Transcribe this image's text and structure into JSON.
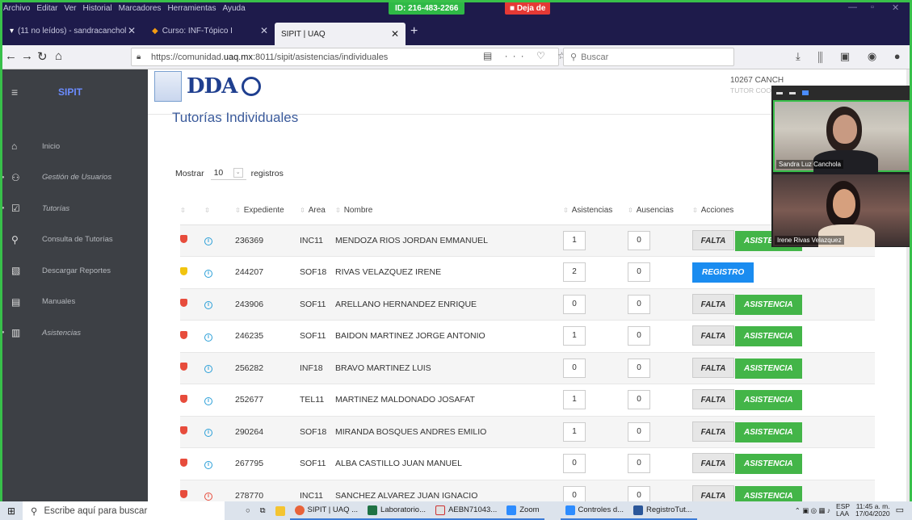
{
  "menu": [
    "Archivo",
    "Editar",
    "Ver",
    "Historial",
    "Marcadores",
    "Herramientas",
    "Ayuda"
  ],
  "zoom": {
    "meeting_id": "ID: 216-483-2266",
    "stop_label": "Deja de"
  },
  "tabs": [
    {
      "label": "(11 no leídos) - sandracanchol"
    },
    {
      "label": "Curso: INF-Tópico I"
    },
    {
      "label": "SIPIT | UAQ"
    }
  ],
  "browser": {
    "url_prefix": "https://comunidad.",
    "url_domain": "uaq.mx",
    "url_suffix": ":8011/sipit/asistencias/individuales",
    "search_placeholder": "Buscar"
  },
  "sidebar": {
    "brand": "SIPIT",
    "items": [
      {
        "label": "Inicio",
        "icon": "home-icon"
      },
      {
        "label": "Gestión de Usuarios",
        "icon": "users-icon"
      },
      {
        "label": "Tutorías",
        "icon": "checkbox-icon"
      },
      {
        "label": "Consulta de Tutorías",
        "icon": "search-icon"
      },
      {
        "label": "Descargar Reportes",
        "icon": "file-icon"
      },
      {
        "label": "Manuales",
        "icon": "file-icon"
      },
      {
        "label": "Asistencias",
        "icon": "chart-icon"
      }
    ]
  },
  "header": {
    "logo_text": "DDA",
    "user_id": "10267 CANCH",
    "user_role": "TUTOR COOR"
  },
  "page": {
    "title": "Tutorías Individuales",
    "show_label": "Mostrar",
    "show_value": "10",
    "records_label": "registros"
  },
  "table": {
    "columns": [
      "",
      "",
      "Expediente",
      "Area",
      "Nombre",
      "Asistencias",
      "Ausencias",
      "Acciones"
    ],
    "falta_label": "FALTA",
    "asistencia_label": "ASISTENCIA",
    "registro_label": "REGISTRO",
    "rows": [
      {
        "status": "red",
        "info": "blue",
        "expediente": "236369",
        "area": "INC11",
        "nombre": "MENDOZA RIOS JORDAN EMMANUEL",
        "asistencias": "1",
        "ausencias": "0",
        "action": "falta-asistencia"
      },
      {
        "status": "yellow",
        "info": "blue",
        "expediente": "244207",
        "area": "SOF18",
        "nombre": "RIVAS VELAZQUEZ IRENE",
        "asistencias": "2",
        "ausencias": "0",
        "action": "registro"
      },
      {
        "status": "red",
        "info": "blue",
        "expediente": "243906",
        "area": "SOF11",
        "nombre": "ARELLANO HERNANDEZ ENRIQUE",
        "asistencias": "0",
        "ausencias": "0",
        "action": "falta-asistencia"
      },
      {
        "status": "red",
        "info": "blue",
        "expediente": "246235",
        "area": "SOF11",
        "nombre": "BAIDON MARTINEZ JORGE ANTONIO",
        "asistencias": "1",
        "ausencias": "0",
        "action": "falta-asistencia"
      },
      {
        "status": "red",
        "info": "blue",
        "expediente": "256282",
        "area": "INF18",
        "nombre": "BRAVO MARTINEZ LUIS",
        "asistencias": "0",
        "ausencias": "0",
        "action": "falta-asistencia"
      },
      {
        "status": "red",
        "info": "blue",
        "expediente": "252677",
        "area": "TEL11",
        "nombre": "MARTINEZ MALDONADO JOSAFAT",
        "asistencias": "1",
        "ausencias": "0",
        "action": "falta-asistencia"
      },
      {
        "status": "red",
        "info": "blue",
        "expediente": "290264",
        "area": "SOF18",
        "nombre": "MIRANDA BOSQUES ANDRES EMILIO",
        "asistencias": "1",
        "ausencias": "0",
        "action": "falta-asistencia"
      },
      {
        "status": "red",
        "info": "blue",
        "expediente": "267795",
        "area": "SOF11",
        "nombre": "ALBA CASTILLO JUAN MANUEL",
        "asistencias": "0",
        "ausencias": "0",
        "action": "falta-asistencia"
      },
      {
        "status": "red",
        "info": "red",
        "expediente": "278770",
        "area": "INC11",
        "nombre": "SANCHEZ ALVAREZ JUAN IGNACIO",
        "asistencias": "0",
        "ausencias": "0",
        "action": "falta-asistencia"
      }
    ]
  },
  "video": {
    "participant1": "Sandra Luz Canchola",
    "participant2": "Irene Rivas Velazquez"
  },
  "taskbar": {
    "search_placeholder": "Escribe aquí para buscar",
    "apps": [
      "SIPIT | UAQ ...",
      "Laboratorio...",
      "AEBN71043...",
      "Zoom",
      "Controles d...",
      "RegistroTut..."
    ],
    "lang": "ESP",
    "lang2": "LAA",
    "time": "11:45 a. m.",
    "date": "17/04/2020"
  },
  "colors": {
    "sidebar_bg": "#3d4045",
    "title_blue": "#3a5a9b",
    "green": "#43b548",
    "blue": "#1a8cf0",
    "red": "#e74c3c"
  }
}
